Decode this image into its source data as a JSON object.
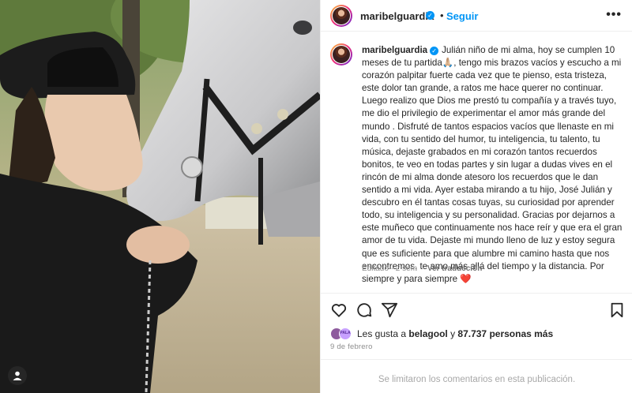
{
  "post": {
    "username": "maribelguardia",
    "verified_icon": "verified-badge-icon",
    "dot": "•",
    "follow_label": "Seguir",
    "more_icon": "more-options-icon"
  },
  "caption": {
    "username": "maribelguardia",
    "text": "Julián niño de mi alma, hoy se cumplen 10 meses de tu partida🙏🏼, tengo mis brazos vacíos y escucho a mi corazón palpitar fuerte cada vez que te pienso, esta tristeza, este dolor tan grande, a ratos me hace querer no continuar. Luego realizo que Dios me prestó tu compañía y a través tuyo, me dio el privilegio de experimentar el amor más grande del mundo . Disfruté de tantos espacios vacíos que llenaste en mi vida, con tu sentido del humor, tu inteligencia, tu talento, tu música, dejaste grabados en mi corazón tantos recuerdos bonitos, te veo en todas partes y sin lugar a dudas vives en el rincón de mi alma donde atesoro los recuerdos que le dan sentido a mi vida. Ayer estaba mirando a tu hijo, José Julián y descubro en él tantas cosas tuyas, su curiosidad por aprender todo, su inteligencia y su personalidad. Gracias por dejarnos a este muñeco que continuamente nos hace reír y que era el gran amor de tu vida. Dejaste mi mundo lleno de luz y estoy segura que es suficiente para que alumbre mi camino hasta que nos encontremos, te amo más allá del tiempo y la distancia. Por siempre y para siempre ❤️",
    "edited": "Editado · 2 sem",
    "translate_label": "Ver traducción"
  },
  "actions": {
    "like_icon": "heart-icon",
    "comment_icon": "comment-icon",
    "share_icon": "share-icon",
    "save_icon": "bookmark-icon"
  },
  "likes": {
    "prefix": "Les gusta a ",
    "user": "belagool",
    "middle": " y ",
    "count": "87.737 personas más",
    "avatar2_label": "PALA"
  },
  "date": "9 de febrero",
  "footer": {
    "comments_limited": "Se limitaron los comentarios en esta publicación."
  },
  "photo": {
    "user_tag_icon": "user-tag-icon"
  }
}
